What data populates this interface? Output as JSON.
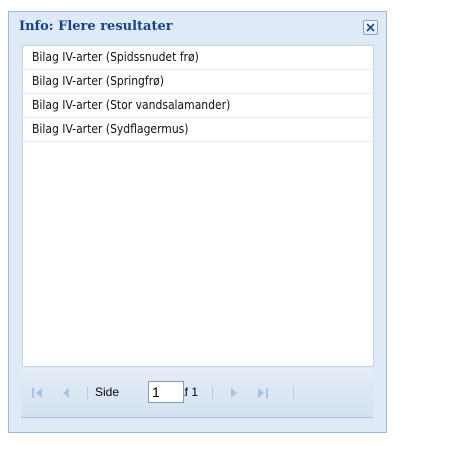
{
  "panel": {
    "title": "Info: Flere resultater",
    "close_icon": "close-icon"
  },
  "results": [
    {
      "label": "Bilag IV-arter (Spidssnudet frø)"
    },
    {
      "label": "Bilag IV-arter (Springfrø)"
    },
    {
      "label": "Bilag IV-arter (Stor vandsalamander)"
    },
    {
      "label": "Bilag IV-arter (Sydflagermus)"
    }
  ],
  "pager": {
    "page_label": "Side",
    "page_value": "1",
    "of_label": "af 1",
    "icons": [
      "first-page-icon",
      "prev-page-icon",
      "next-page-icon",
      "last-page-icon"
    ]
  },
  "colors": {
    "panel_background": "#dfeaf7",
    "panel_border": "#99bbe8",
    "title_text": "#15428b",
    "nav_icon": "#a8c3e3"
  }
}
